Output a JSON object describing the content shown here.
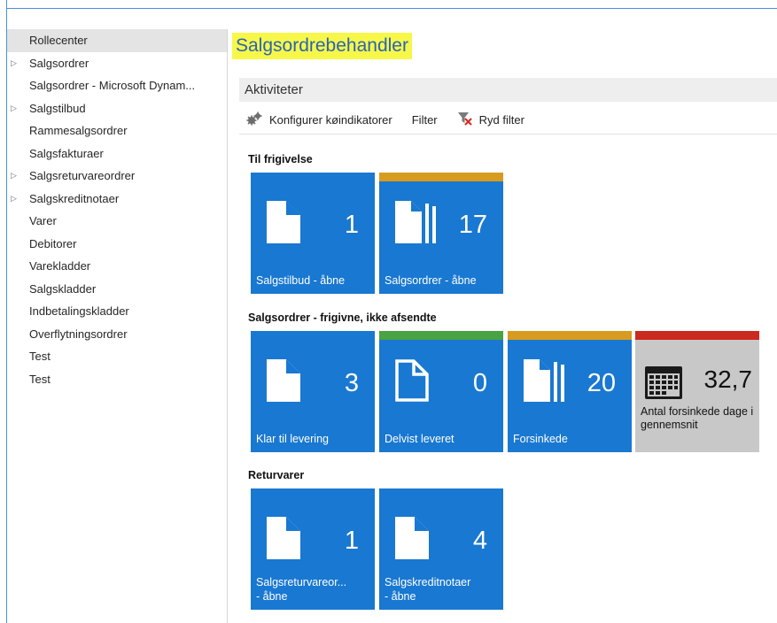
{
  "sidebar": {
    "items": [
      {
        "label": "Rollecenter",
        "expandable": false,
        "selected": true
      },
      {
        "label": "Salgsordrer",
        "expandable": true
      },
      {
        "label": "Salgsordrer - Microsoft Dynam...",
        "expandable": false
      },
      {
        "label": "Salgstilbud",
        "expandable": true
      },
      {
        "label": "Rammesalgsordrer",
        "expandable": false
      },
      {
        "label": "Salgsfakturaer",
        "expandable": false
      },
      {
        "label": "Salgsreturvareordrer",
        "expandable": true
      },
      {
        "label": "Salgskreditnotaer",
        "expandable": true
      },
      {
        "label": "Varer",
        "expandable": false
      },
      {
        "label": "Debitorer",
        "expandable": false
      },
      {
        "label": "Varekladder",
        "expandable": false
      },
      {
        "label": "Salgskladder",
        "expandable": false
      },
      {
        "label": "Indbetalingskladder",
        "expandable": false
      },
      {
        "label": "Overflytningsordrer",
        "expandable": false
      },
      {
        "label": "Test",
        "expandable": false
      },
      {
        "label": "Test",
        "expandable": false
      }
    ],
    "expander_glyph": "▷"
  },
  "page": {
    "title": "Salgsordrebehandler",
    "highlight_color": "#f7f74a",
    "title_color": "#2a64b4"
  },
  "activities": {
    "header": "Aktiviteter",
    "actions": {
      "configure": {
        "label": "Konfigurer køindikatorer",
        "icon": "configure-cues-icon"
      },
      "filter": {
        "label": "Filter"
      },
      "clear_filter": {
        "label": "Ryd filter",
        "icon": "clear-filter-icon"
      }
    }
  },
  "groups": {
    "release": {
      "title": "Til frigivelse",
      "tiles": [
        {
          "count": "1",
          "label": "Salgstilbud - åbne",
          "icon": "document-icon",
          "stripe": null
        },
        {
          "count": "17",
          "label": "Salgsordrer - åbne",
          "icon": "documents-stack-icon",
          "stripe": "#d79b1f"
        }
      ]
    },
    "released": {
      "title": "Salgsordrer - frigivne, ikke afsendte",
      "tiles": [
        {
          "count": "3",
          "label": "Klar til levering",
          "icon": "document-icon",
          "stripe": null
        },
        {
          "count": "0",
          "label": "Delvist leveret",
          "icon": "document-outline-icon",
          "stripe": "#4aa343"
        },
        {
          "count": "20",
          "label": "Forsinkede",
          "icon": "documents-stack-icon",
          "stripe": "#d79b1f"
        },
        {
          "count": "32,7",
          "label": "Antal forsinkede dage i gennemsnit",
          "icon": "calendar-icon",
          "stripe": "#cc2a1e"
        }
      ]
    },
    "returns": {
      "title": "Returvarer",
      "tiles": [
        {
          "count": "1",
          "label_line1": "Salgsreturvareor...",
          "label_line2": "- åbne",
          "icon": "document-icon",
          "stripe": null
        },
        {
          "count": "4",
          "label_line1": "Salgskreditnotaer",
          "label_line2": "- åbne",
          "icon": "document-icon",
          "stripe": null
        }
      ]
    }
  },
  "colors": {
    "tile_blue": "#1978d1",
    "tile_gray": "#c8c8c8",
    "stripe_orange": "#d79b1f",
    "stripe_green": "#4aa343",
    "stripe_red": "#cc2a1e",
    "frame_blue": "#4a90d9"
  }
}
